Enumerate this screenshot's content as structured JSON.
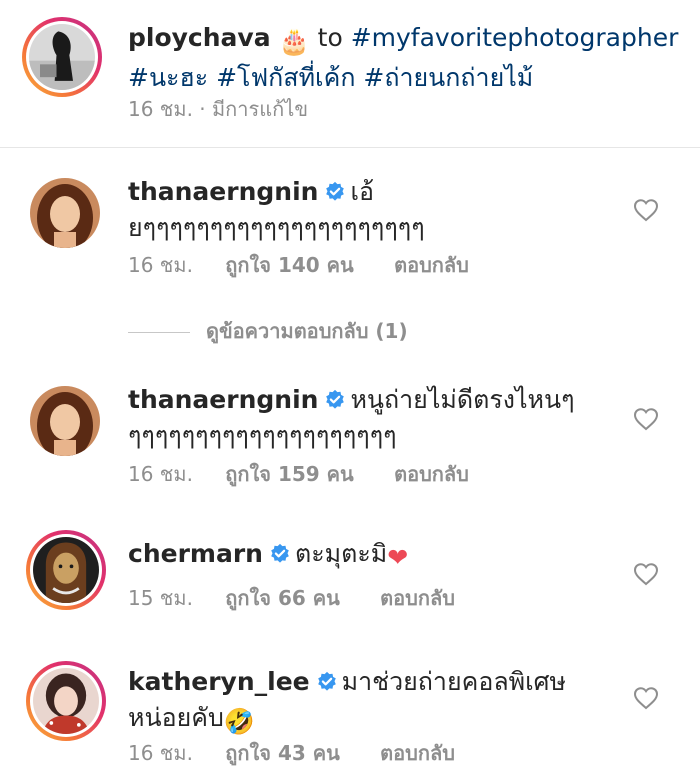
{
  "caption": {
    "username": "ploychava",
    "cake_emoji": "🎂",
    "to_text": "to",
    "mention_tag": "#myfavoritephotographer",
    "hashtags_line": "#นะฮะ #โฟกัสที่เค้ก #ถ่ายนกถ่ายไม้",
    "time": "16 ชม.",
    "separator": "·",
    "edited": "มีการแก้ไข"
  },
  "comments": [
    {
      "username": "thanaerngnin",
      "verified": true,
      "text_line1": "เอ้",
      "text_line2": "ยๆๆๆๆๆๆๆๆๆๆๆๆๆๆๆๆๆๆๆๆๆ",
      "time": "16 ชม.",
      "likes": "ถูกใจ 140 คน",
      "reply_label": "ตอบกลับ"
    },
    {
      "username": "thanaerngnin",
      "verified": true,
      "text_line1": "หนูถ่ายไม่ดีตรงไหนๆ",
      "text_line2": "ๆๆๆๆๆๆๆๆๆๆๆๆๆๆๆๆๆๆๆๆ",
      "time": "16 ชม.",
      "likes": "ถูกใจ 159 คน",
      "reply_label": "ตอบกลับ"
    },
    {
      "username": "chermarn",
      "verified": true,
      "text_line1": "ตะมุตะมิ",
      "emoji": "❤",
      "time": "15 ชม.",
      "likes": "ถูกใจ 66 คน",
      "reply_label": "ตอบกลับ"
    },
    {
      "username": "katheryn_lee",
      "verified": true,
      "text_line1": "มาช่วยถ่ายคอลพิเศษ",
      "text_line2": "หน่อยคับ",
      "emoji": "🤣",
      "time": "16 ชม.",
      "likes": "ถูกใจ 43 คน",
      "reply_label": "ตอบกลับ"
    }
  ],
  "view_replies": {
    "label": "ดูข้อความตอบกลับ (1)"
  },
  "icons": {
    "heart": "heart-outline-icon",
    "verified": "verified-badge-icon"
  },
  "colors": {
    "verified_blue": "#3897f0",
    "hashtag_blue": "#00376b",
    "meta_gray": "#8e8e8e",
    "heart_red": "#ed4956"
  }
}
